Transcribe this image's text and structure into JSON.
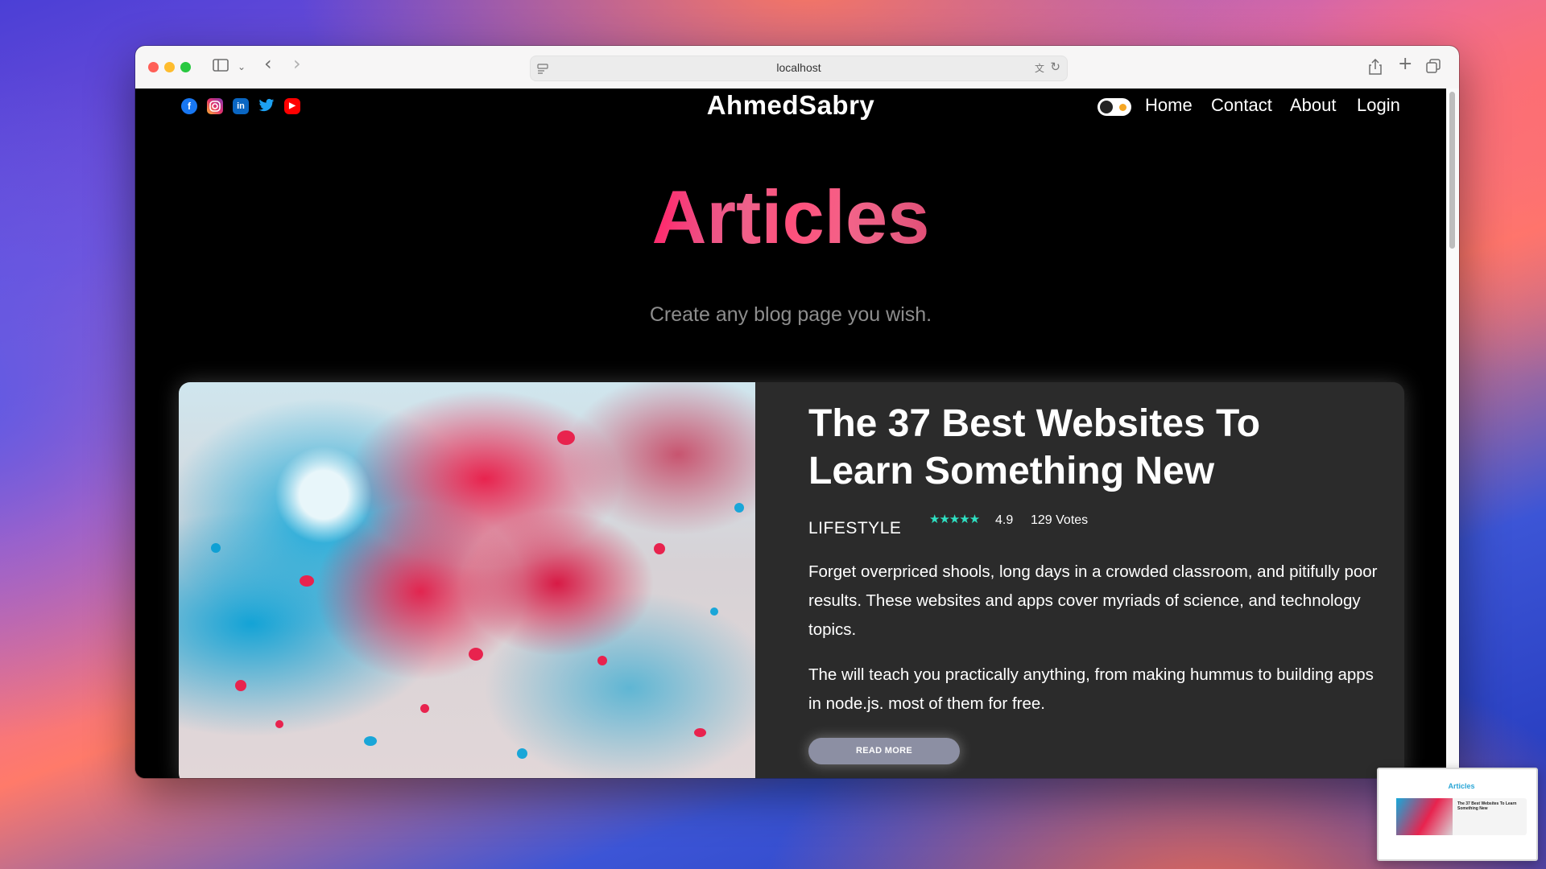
{
  "browser": {
    "url": "localhost"
  },
  "site": {
    "logo": "AhmedSabry",
    "social_icons": [
      "facebook-icon",
      "instagram-icon",
      "linkedin-icon",
      "twitter-icon",
      "youtube-icon"
    ],
    "nav": [
      "Home",
      "Contact",
      "About",
      "Login"
    ]
  },
  "hero": {
    "title": "Articles",
    "subtitle": "Create any blog page you wish."
  },
  "article": {
    "title": "The 37 Best Websites To Learn Something New",
    "category": "LIFESTYLE",
    "stars": "★★★★★",
    "rating": "4.9",
    "votes": "129 Votes",
    "paragraph1": "Forget overpriced shools, long days in a crowded classroom, and pitifully poor results. These websites and apps cover myriads of science, and technology topics.",
    "paragraph2": "The will teach you practically anything, from making hummus to building apps in node.js. most of them for free.",
    "button": "READ MORE"
  },
  "thumbnail": {
    "title": "Articles",
    "article_title": "The 37 Best Websites To Learn Something New"
  },
  "colors": {
    "star": "#2ee0c2",
    "card_bg": "#2b2b2b",
    "button_bg": "#8c8fa3"
  }
}
